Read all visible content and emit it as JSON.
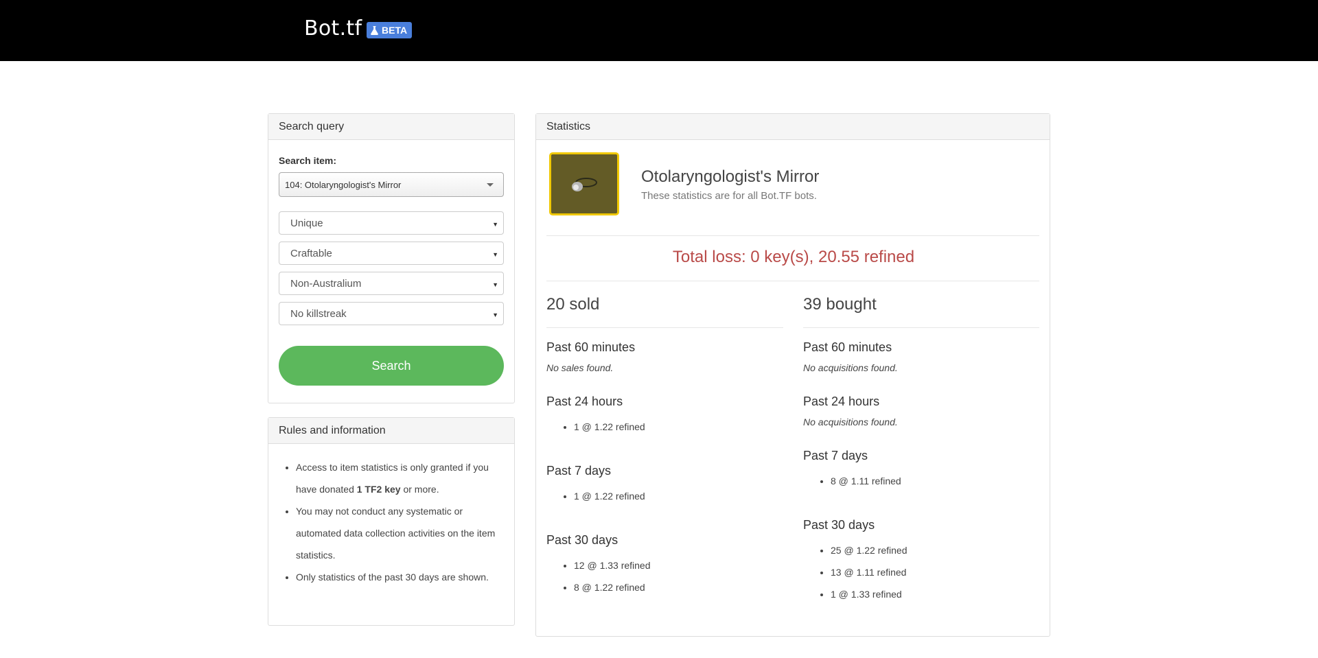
{
  "header": {
    "brand": "Bot.tf",
    "badge": "BETA"
  },
  "search": {
    "panel_title": "Search query",
    "field_label": "Search item:",
    "item_value": "104: Otolaryngologist's Mirror",
    "quality": "Unique",
    "craftable": "Craftable",
    "australium": "Non-Australium",
    "killstreak": "No killstreak",
    "button": "Search"
  },
  "rules": {
    "panel_title": "Rules and information",
    "items": [
      {
        "before": "Access to item statistics is only granted if you have donated ",
        "bold": "1 TF2 key",
        "after": " or more."
      },
      {
        "text": "You may not conduct any systematic or automated data collection activities on the item statistics."
      },
      {
        "text": "Only statistics of the past 30 days are shown."
      }
    ]
  },
  "stats": {
    "panel_title": "Statistics",
    "item_name": "Otolaryngologist's Mirror",
    "subtitle": "These statistics are for all Bot.TF bots.",
    "total_loss": "Total loss: 0 key(s), 20.55 refined",
    "sold": {
      "title": "20 sold",
      "p60_label": "Past 60 minutes",
      "p60_none": "No sales found.",
      "p24_label": "Past 24 hours",
      "p24": [
        "1 @ 1.22 refined"
      ],
      "p7_label": "Past 7 days",
      "p7": [
        "1 @ 1.22 refined"
      ],
      "p30_label": "Past 30 days",
      "p30": [
        "12 @ 1.33 refined",
        "8 @ 1.22 refined"
      ]
    },
    "bought": {
      "title": "39 bought",
      "p60_label": "Past 60 minutes",
      "p60_none": "No acquisitions found.",
      "p24_label": "Past 24 hours",
      "p24_none": "No acquisitions found.",
      "p7_label": "Past 7 days",
      "p7": [
        "8 @ 1.11 refined"
      ],
      "p30_label": "Past 30 days",
      "p30": [
        "25 @ 1.22 refined",
        "13 @ 1.11 refined",
        "1 @ 1.33 refined"
      ]
    }
  },
  "colors": {
    "topbar": "#000000",
    "badge": "#4a7fdc",
    "search_button": "#5cb85c",
    "loss_text": "#b94a48",
    "item_border": "#f0c800",
    "item_bg": "#635b26"
  }
}
